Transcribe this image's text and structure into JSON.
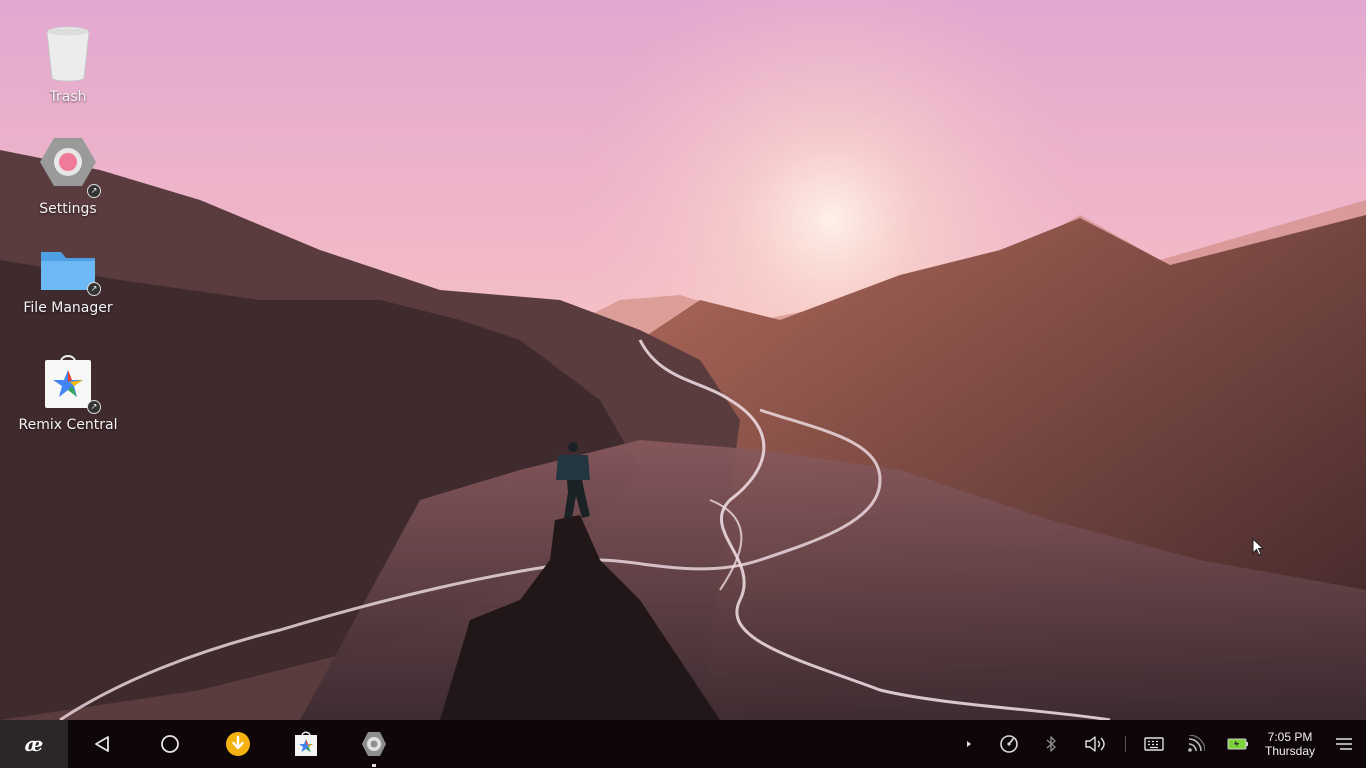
{
  "desktop": {
    "icons": [
      {
        "label": "Trash",
        "icon": "trash-icon"
      },
      {
        "label": "Settings",
        "icon": "settings-gear-icon"
      },
      {
        "label": "File Manager",
        "icon": "folder-icon"
      },
      {
        "label": "Remix Central",
        "icon": "remix-central-icon"
      }
    ]
  },
  "taskbar": {
    "start_icon": "remix-logo-icon",
    "start_label": "æ",
    "nav": [
      "back-icon",
      "home-icon"
    ],
    "apps": [
      "download-app-icon",
      "remix-central-app-icon",
      "settings-app-icon"
    ],
    "tray": {
      "icons": [
        "expand-arrow-icon",
        "speed-gauge-icon",
        "bluetooth-icon",
        "volume-icon",
        "keyboard-icon",
        "wifi-signal-icon",
        "battery-icon",
        "notification-menu-icon"
      ],
      "time": "7:05 PM",
      "day": "Thursday"
    }
  },
  "colors": {
    "taskbar_bg": "#0e0607",
    "start_bg": "#2b2627",
    "download_accent": "#f3b212",
    "battery_accent": "#7ed43a",
    "folder_blue": "#5aaef0"
  }
}
